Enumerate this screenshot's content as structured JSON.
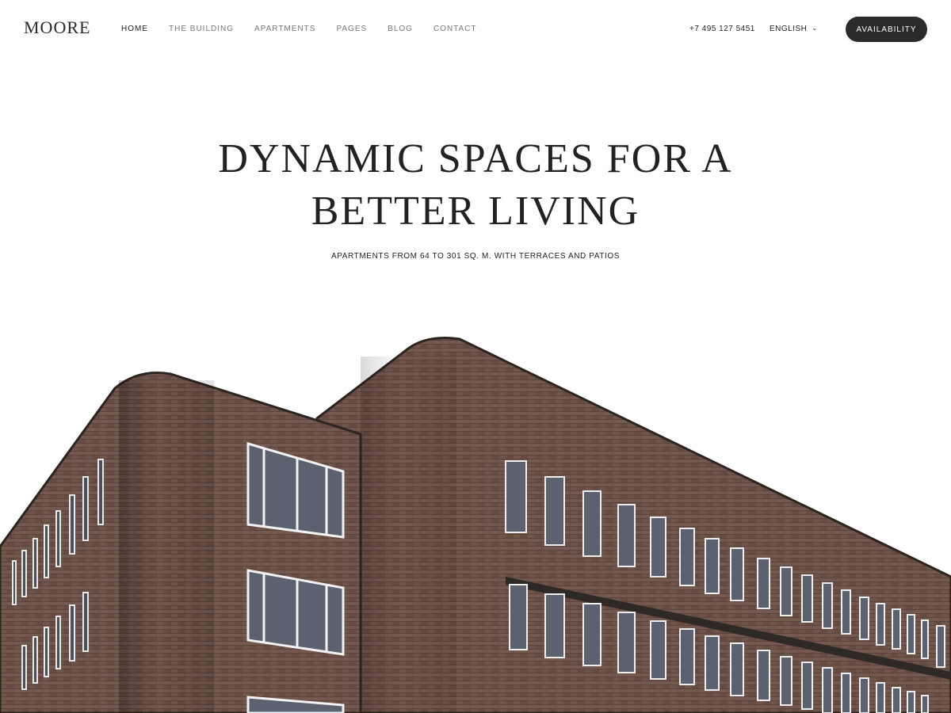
{
  "header": {
    "logo": "MOORE",
    "nav": [
      {
        "label": "HOME",
        "active": true
      },
      {
        "label": "THE BUILDING",
        "active": false
      },
      {
        "label": "APARTMENTS",
        "active": false
      },
      {
        "label": "PAGES",
        "active": false
      },
      {
        "label": "BLOG",
        "active": false
      },
      {
        "label": "CONTACT",
        "active": false
      }
    ],
    "phone": "+7 495 127 5451",
    "language": "ENGLISH",
    "cta_label": "AVAILABILITY"
  },
  "hero": {
    "title_line1": "DYNAMIC SPACES FOR A",
    "title_line2": "BETTER LIVING",
    "subtitle": "APARTMENTS FROM 64 TO 301 SQ. M. WITH TERRACES AND PATIOS"
  },
  "colors": {
    "accent": "#2a2a2a",
    "brick": "#6b5148",
    "window": "#5c6170"
  },
  "icons": {
    "language_dropdown": "chevron-down-icon"
  }
}
